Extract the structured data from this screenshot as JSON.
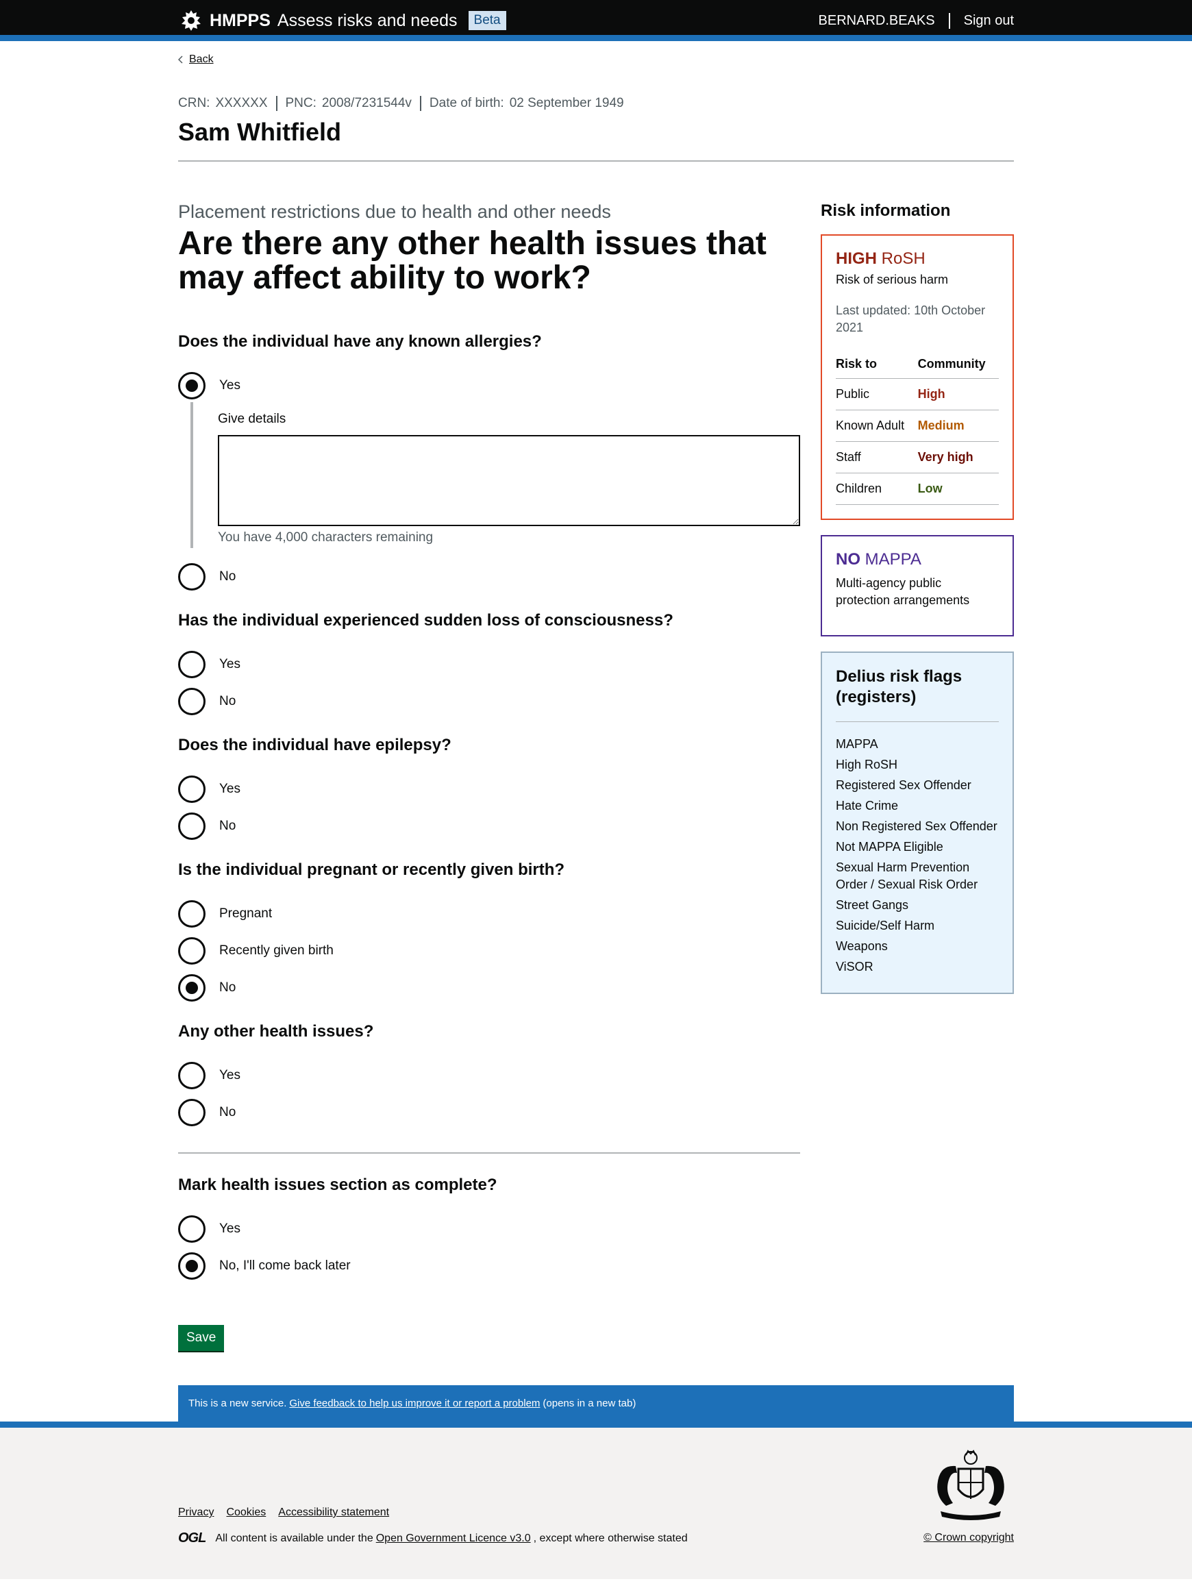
{
  "header": {
    "org": "HMPPS",
    "service_name": "Assess risks and needs",
    "phase_tag": "Beta",
    "username": "BERNARD.BEAKS",
    "signout_label": "Sign out"
  },
  "back_link": "Back",
  "person": {
    "crn_label": "CRN:",
    "crn": "XXXXXX",
    "pnc_label": "PNC:",
    "pnc": "2008/7231544v",
    "dob_label": "Date of birth:",
    "dob": "02 September 1949",
    "name": "Sam Whitfield"
  },
  "page": {
    "caption": "Placement restrictions due to health and other needs",
    "heading": "Are there any other health issues that may affect ability to work?"
  },
  "questions": {
    "allergies": {
      "label": "Does the individual have any known allergies?",
      "yes": "Yes",
      "details_label": "Give details",
      "details_value": "",
      "char_hint": "You have 4,000 characters remaining",
      "no": "No",
      "selected": "Yes"
    },
    "consciousness": {
      "label": "Has the individual experienced sudden loss of consciousness?",
      "yes": "Yes",
      "no": "No",
      "selected": ""
    },
    "epilepsy": {
      "label": "Does the individual have epilepsy?",
      "yes": "Yes",
      "no": "No",
      "selected": ""
    },
    "pregnancy": {
      "label": "Is the individual pregnant or recently given birth?",
      "pregnant": "Pregnant",
      "recent_birth": "Recently given birth",
      "no": "No",
      "selected": "No"
    },
    "other": {
      "label": "Any other health issues?",
      "yes": "Yes",
      "no": "No",
      "selected": ""
    },
    "complete": {
      "label": "Mark health issues section as complete?",
      "yes": "Yes",
      "no": "No, I'll come back later",
      "selected": "No, I'll come back later"
    }
  },
  "save_label": "Save",
  "sidebar": {
    "title": "Risk information",
    "rosh": {
      "level": "HIGH",
      "suffix": "RoSH",
      "subtitle": "Risk of serious harm",
      "updated": "Last updated: 10th October 2021",
      "col1": "Risk to",
      "col2": "Community",
      "rows": [
        {
          "who": "Public",
          "level": "High"
        },
        {
          "who": "Known Adult",
          "level": "Medium"
        },
        {
          "who": "Staff",
          "level": "Very high"
        },
        {
          "who": "Children",
          "level": "Low"
        }
      ]
    },
    "mappa": {
      "level": "NO",
      "suffix": "MAPPA",
      "subtitle": "Multi-agency public protection arrangements"
    },
    "flags": {
      "title": "Delius risk flags (registers)",
      "items": [
        "MAPPA",
        "High RoSH",
        "Registered Sex Offender",
        "Hate Crime",
        "Non Registered Sex Offender",
        "Not MAPPA Eligible",
        "Sexual Harm Prevention Order / Sexual Risk Order",
        "Street Gangs",
        "Suicide/Self Harm",
        "Weapons",
        "ViSOR"
      ]
    }
  },
  "feedback": {
    "prefix": "This is a new service.",
    "link": "Give feedback to help us improve it or report a problem",
    "suffix": "(opens in a new tab)"
  },
  "footer": {
    "links": [
      "Privacy",
      "Cookies",
      "Accessibility statement"
    ],
    "ogl": "OGL",
    "licence_prefix": "All content is available under the",
    "licence_link": "Open Government Licence v3.0",
    "licence_suffix": ", except where otherwise stated",
    "copyright": "© Crown copyright"
  },
  "colors": {
    "header_bg": "#0b0c0c",
    "brand_blue": "#1d70b8",
    "save_green": "#00703c",
    "rosh_red": "#e24a27",
    "mappa_purple": "#4c2c92"
  }
}
